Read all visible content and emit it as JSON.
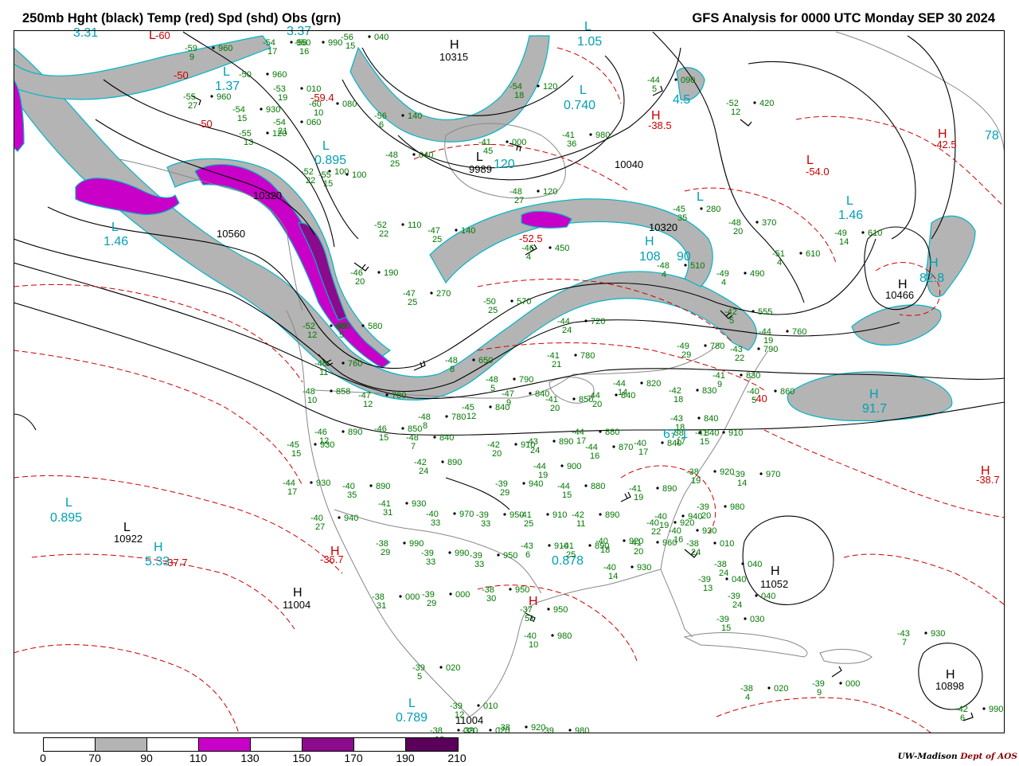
{
  "header": {
    "left_title": "250mb Hght (black) Temp (red) Spd (shd) Obs (grn)",
    "right_title": "GFS Analysis for 0000 UTC Monday  SEP 30 2024"
  },
  "legend": {
    "labels": [
      "0",
      "70",
      "90",
      "110",
      "130",
      "150",
      "170",
      "190",
      "210"
    ],
    "colors": [
      "#ffffff",
      "#b4b4b4",
      "#ffffff",
      "#c800c8",
      "#ffffff",
      "#8c0a8c",
      "#ffffff",
      "#5a005a"
    ]
  },
  "credit": {
    "org": "UW-Madison",
    "dept": "Dept of AOS"
  },
  "colors": {
    "height": "#000000",
    "temperature": "#cc0000",
    "observations": "#007700",
    "speed_label": "#00a0b4",
    "speed_70_90": "#b4b4b4",
    "speed_110_130": "#c800c8",
    "speed_150_170": "#8c0a8c",
    "speed_190_210": "#5a005a"
  },
  "centers": {
    "height_labels": [
      "10315",
      "10320",
      "10560",
      "9989",
      "10040",
      "10320",
      "10466",
      "10922",
      "11004",
      "11052",
      "10898",
      "11004"
    ],
    "height_marks": [
      "H",
      "L",
      "L",
      "H",
      "H",
      "H",
      "H"
    ],
    "temp_labels": [
      "-60",
      "-50",
      "-50",
      "-59.4",
      "-38.5",
      "-54.0",
      "-42.5",
      "-52.5",
      "-36.7",
      "-37.7",
      "-38.7",
      "-40"
    ],
    "temp_marks": [
      "L",
      "H",
      "L",
      "H",
      "H",
      "H",
      "H"
    ],
    "speed_labels": [
      "3.31",
      "1.05",
      "1.37",
      "0.740",
      "0.895",
      "1.46",
      "1.46",
      "82.8",
      "78",
      "91.7",
      "90",
      "0.895",
      "0.789",
      "0.878",
      "3.37",
      "108",
      "5.33",
      "4.5",
      "67.1",
      "120"
    ],
    "speed_marks": [
      "L",
      "L",
      "L",
      "L",
      "L",
      "H",
      "H",
      "L",
      "H",
      "L",
      "L",
      "H",
      "L"
    ]
  },
  "observations": [
    {
      "temp": "-59",
      "height": "960",
      "dew": "9"
    },
    {
      "temp": "-54",
      "height": "950",
      "dew": "17"
    },
    {
      "temp": "-56",
      "height": "990",
      "dew": "16"
    },
    {
      "temp": "-56",
      "height": "040",
      "dew": "15"
    },
    {
      "temp": "-50",
      "height": "960",
      "dew": ""
    },
    {
      "temp": "-55",
      "height": "960",
      "dew": "27"
    },
    {
      "temp": "-53",
      "height": "010",
      "dew": "19"
    },
    {
      "temp": "-60",
      "height": "080",
      "dew": "10"
    },
    {
      "temp": "-54",
      "height": "930",
      "dew": "15"
    },
    {
      "temp": "-54",
      "height": "060",
      "dew": "21"
    },
    {
      "temp": "-55",
      "height": "120",
      "dew": "13"
    },
    {
      "temp": "-56",
      "height": "140",
      "dew": "6"
    },
    {
      "temp": "-54",
      "height": "120",
      "dew": "18"
    },
    {
      "temp": "-44",
      "height": "090",
      "dew": "5"
    },
    {
      "temp": "-52",
      "height": "420",
      "dew": "12"
    },
    {
      "temp": "-41",
      "height": "980",
      "dew": "36"
    },
    {
      "temp": "-41",
      "height": "000",
      "dew": "45"
    },
    {
      "temp": "-48",
      "height": "040",
      "dew": "25"
    },
    {
      "temp": "-52",
      "height": "100",
      "dew": "22"
    },
    {
      "temp": "-55",
      "height": "100",
      "dew": "15"
    },
    {
      "temp": "-48",
      "height": "120",
      "dew": "27"
    },
    {
      "temp": "-45",
      "height": "280",
      "dew": "35"
    },
    {
      "temp": "-48",
      "height": "370",
      "dew": "20"
    },
    {
      "temp": "-52",
      "height": "110",
      "dew": "22"
    },
    {
      "temp": "-47",
      "height": "140",
      "dew": "25"
    },
    {
      "temp": "-49",
      "height": "610",
      "dew": "14"
    },
    {
      "temp": "-51",
      "height": "610",
      "dew": "4"
    },
    {
      "temp": "-48",
      "height": "510",
      "dew": "4"
    },
    {
      "temp": "-46",
      "height": "450",
      "dew": "4"
    },
    {
      "temp": "-49",
      "height": "490",
      "dew": "4"
    },
    {
      "temp": "-46",
      "height": "190",
      "dew": "20"
    },
    {
      "temp": "-47",
      "height": "270",
      "dew": "25"
    },
    {
      "temp": "-50",
      "height": "570",
      "dew": "25"
    },
    {
      "temp": "-52",
      "height": "660",
      "dew": "12"
    },
    {
      "temp": "-44",
      "height": "720",
      "dew": "24"
    },
    {
      "temp": "-49",
      "height": "780",
      "dew": "29"
    },
    {
      "temp": "-43",
      "height": "790",
      "dew": "22"
    },
    {
      "temp": "-44",
      "height": "760",
      "dew": "19"
    },
    {
      "temp": "-42",
      "height": "555",
      "dew": "5"
    },
    {
      "temp": "-48",
      "height": "760",
      "dew": "11"
    },
    {
      "temp": "-48",
      "height": "580",
      "dew": "5"
    },
    {
      "temp": "-48",
      "height": "650",
      "dew": "8"
    },
    {
      "temp": "-41",
      "height": "780",
      "dew": "21"
    },
    {
      "temp": "-48",
      "height": "790",
      "dew": "5"
    },
    {
      "temp": "-47",
      "height": "840",
      "dew": "9"
    },
    {
      "temp": "-41",
      "height": "850",
      "dew": "20"
    },
    {
      "temp": "-44",
      "height": "840",
      "dew": "20"
    },
    {
      "temp": "-44",
      "height": "820",
      "dew": "14"
    },
    {
      "temp": "-42",
      "height": "830",
      "dew": "18"
    },
    {
      "temp": "-41",
      "height": "830",
      "dew": "9"
    },
    {
      "temp": "-40",
      "height": "860",
      "dew": "5"
    },
    {
      "temp": "-48",
      "height": "858",
      "dew": "10"
    },
    {
      "temp": "-47",
      "height": "780",
      "dew": "12"
    },
    {
      "temp": "-48",
      "height": "780",
      "dew": "8"
    },
    {
      "temp": "-45",
      "height": "840",
      "dew": "12"
    },
    {
      "temp": "-43",
      "height": "840",
      "dew": "18"
    },
    {
      "temp": "-38",
      "height": "840",
      "dew": "17"
    },
    {
      "temp": "-46",
      "height": "890",
      "dew": "12"
    },
    {
      "temp": "-46",
      "height": "850",
      "dew": "15"
    },
    {
      "temp": "-48",
      "height": "840",
      "dew": "7"
    },
    {
      "temp": "-42",
      "height": "910",
      "dew": "20"
    },
    {
      "temp": "-43",
      "height": "890",
      "dew": "24"
    },
    {
      "temp": "-44",
      "height": "880",
      "dew": "17"
    },
    {
      "temp": "-44",
      "height": "870",
      "dew": "16"
    },
    {
      "temp": "-40",
      "height": "840",
      "dew": "17"
    },
    {
      "temp": "-41",
      "height": "910",
      "dew": "15"
    },
    {
      "temp": "-45",
      "height": "930",
      "dew": "15"
    },
    {
      "temp": "-42",
      "height": "890",
      "dew": "24"
    },
    {
      "temp": "-44",
      "height": "900",
      "dew": "19"
    },
    {
      "temp": "-44",
      "height": "880",
      "dew": "15"
    },
    {
      "temp": "-41",
      "height": "890",
      "dew": "19"
    },
    {
      "temp": "-40",
      "height": "930",
      "dew": "16"
    },
    {
      "temp": "-38",
      "height": "920",
      "dew": "19"
    },
    {
      "temp": "-39",
      "height": "970",
      "dew": "14"
    },
    {
      "temp": "-44",
      "height": "930",
      "dew": "17"
    },
    {
      "temp": "-40",
      "height": "890",
      "dew": "35"
    },
    {
      "temp": "-39",
      "height": "940",
      "dew": "29"
    },
    {
      "temp": "-41",
      "height": "930",
      "dew": "31"
    },
    {
      "temp": "-40",
      "height": "970",
      "dew": "33"
    },
    {
      "temp": "-39",
      "height": "950",
      "dew": "33"
    },
    {
      "temp": "-41",
      "height": "910",
      "dew": "25"
    },
    {
      "temp": "-42",
      "height": "890",
      "dew": "11"
    },
    {
      "temp": "-40",
      "height": "940",
      "dew": "27"
    },
    {
      "temp": "-40",
      "height": "920",
      "dew": "22"
    },
    {
      "temp": "-40",
      "height": "940",
      "dew": "19"
    },
    {
      "temp": "-39",
      "height": "980",
      "dew": "20"
    },
    {
      "temp": "-38",
      "height": "990",
      "dew": "29"
    },
    {
      "temp": "-39",
      "height": "990",
      "dew": "33"
    },
    {
      "temp": "-39",
      "height": "950",
      "dew": "33"
    },
    {
      "temp": "-43",
      "height": "910",
      "dew": "6"
    },
    {
      "temp": "-41",
      "height": "890",
      "dew": "25"
    },
    {
      "temp": "-40",
      "height": "920",
      "dew": "18"
    },
    {
      "temp": "-41",
      "height": "960",
      "dew": "20"
    },
    {
      "temp": "-40",
      "height": "930",
      "dew": "14"
    },
    {
      "temp": "-38",
      "height": "010",
      "dew": "24"
    },
    {
      "temp": "-38",
      "height": "040",
      "dew": "24"
    },
    {
      "temp": "-39",
      "height": "040",
      "dew": "13"
    },
    {
      "temp": "-39",
      "height": "040",
      "dew": "24"
    },
    {
      "temp": "-39",
      "height": "030",
      "dew": "15"
    },
    {
      "temp": "-38",
      "height": "000",
      "dew": "31"
    },
    {
      "temp": "-39",
      "height": "000",
      "dew": "29"
    },
    {
      "temp": "-38",
      "height": "950",
      "dew": "30"
    },
    {
      "temp": "-37",
      "height": "950",
      "dew": "51"
    },
    {
      "temp": "-40",
      "height": "980",
      "dew": "10"
    },
    {
      "temp": "-39",
      "height": "020",
      "dew": "5"
    },
    {
      "temp": "-39",
      "height": "010",
      "dew": "12"
    },
    {
      "temp": "-38",
      "height": "020",
      "dew": "10"
    },
    {
      "temp": "-38",
      "height": "020",
      "dew": "4"
    },
    {
      "temp": "-39",
      "height": "000",
      "dew": "9"
    },
    {
      "temp": "-43",
      "height": "930",
      "dew": "7"
    },
    {
      "temp": "-42",
      "height": "990",
      "dew": "6"
    },
    {
      "temp": "-39",
      "height": "020",
      "dew": ""
    },
    {
      "temp": "-38",
      "height": "920",
      "dew": ""
    },
    {
      "temp": "-39",
      "height": "980",
      "dew": ""
    }
  ]
}
